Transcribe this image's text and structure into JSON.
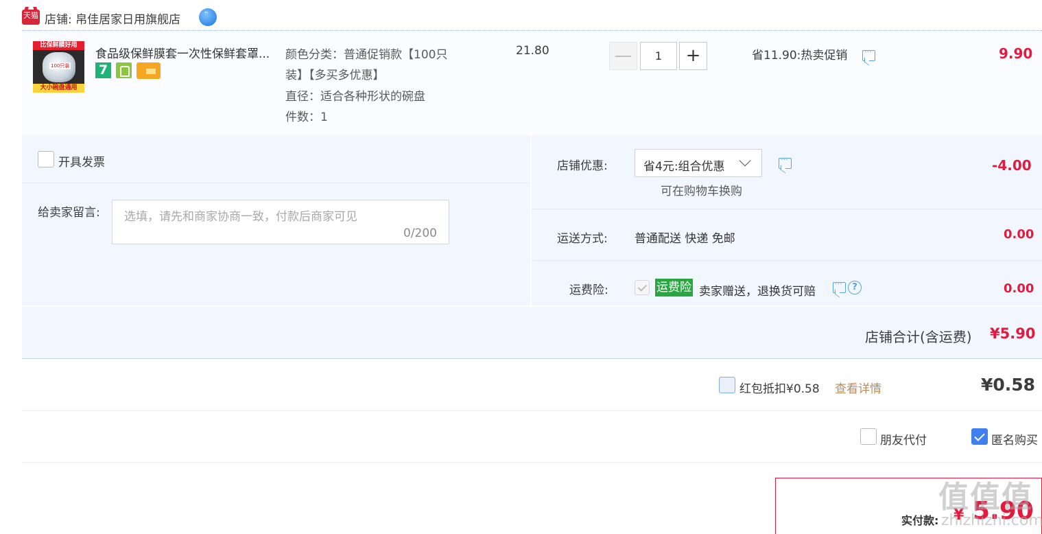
{
  "shop": {
    "logo_text": "天猫",
    "label": "店铺: 帛佳居家日用旗舰店"
  },
  "item": {
    "thumb_top_text": "比保鲜膜好用",
    "thumb_count_text": "100只装",
    "thumb_bottom_text": "大小碗盘通用",
    "title": "食品级保鲜膜套一次性保鲜套罩...",
    "badge_7": "7",
    "sku_line1": "颜色分类：普通促销款【100只",
    "sku_line2": "装】【多买多优惠】",
    "sku_line3": "直径：适合各种形状的碗盘",
    "sku_line4": "件数：1",
    "unit_price": "21.80",
    "quantity": "1",
    "minus_symbol": "—",
    "plus_symbol": "+",
    "promo": "省11.90:热卖促销",
    "subtotal": "9.90"
  },
  "invoice": {
    "label": "开具发票"
  },
  "message": {
    "label": "给卖家留言:",
    "placeholder": "选填，请先和商家协商一致，付款后商家可见",
    "counter": "0/200"
  },
  "shop_discount": {
    "label": "店铺优惠:",
    "selected": "省4元:组合优惠",
    "hint": "可在购物车换购",
    "amount": "-4.00"
  },
  "shipping": {
    "label": "运送方式:",
    "value": "普通配送 快递 免邮",
    "amount": "0.00"
  },
  "insurance": {
    "label": "运费险:",
    "tag": "运费险",
    "desc": "卖家赠送，退换货可赔",
    "help": "?",
    "amount": "0.00"
  },
  "shop_total": {
    "label": "店铺合计(含运费)",
    "amount": "¥5.90"
  },
  "red_packet": {
    "label": "红包抵扣¥0.58",
    "link": "查看详情",
    "amount": "¥0.58"
  },
  "options": {
    "friend_pay": "朋友代付",
    "anonymous": "匿名购买",
    "anonymous_checked": true
  },
  "payment": {
    "label": "实付款:",
    "currency": "¥",
    "amount": "5.90"
  },
  "watermark": {
    "text": "值值值",
    "sub": "zhizhizhi.com"
  },
  "colors": {
    "price_red": "#e4193e",
    "panel_bg": "#f2f7ff",
    "check_blue": "#3f7ff0",
    "insurance_green": "#2aa640",
    "link_brown": "#b88a5c"
  }
}
